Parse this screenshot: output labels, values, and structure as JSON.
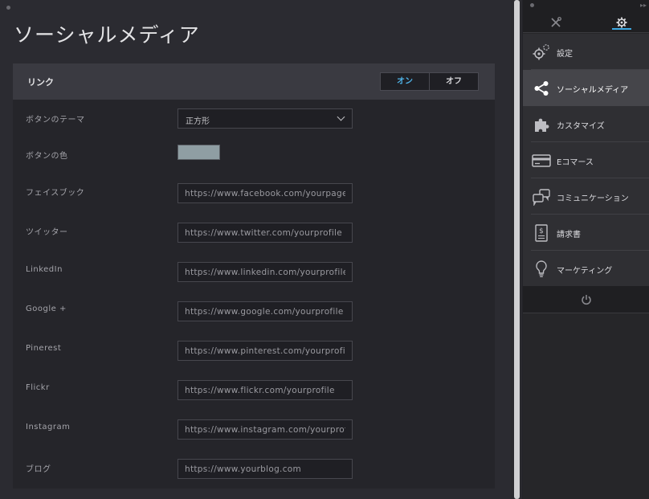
{
  "page": {
    "title": "ソーシャルメディア"
  },
  "section": {
    "title": "リンク",
    "toggle": {
      "on_label": "オン",
      "off_label": "オフ",
      "selected": "on"
    }
  },
  "settings": {
    "theme": {
      "label": "ボタンのテーマ",
      "value": "正方形"
    },
    "color": {
      "label": "ボタンの色",
      "value": "#8f9ea3"
    }
  },
  "links": [
    {
      "label": "フェイスブック",
      "placeholder": "https://www.facebook.com/yourpage"
    },
    {
      "label": "ツイッター",
      "placeholder": "https://www.twitter.com/yourprofile"
    },
    {
      "label": "LinkedIn",
      "placeholder": "https://www.linkedin.com/yourprofile"
    },
    {
      "label": "Google +",
      "placeholder": "https://www.google.com/yourprofile"
    },
    {
      "label": "Pinerest",
      "placeholder": "https://www.pinterest.com/yourprofile"
    },
    {
      "label": "Flickr",
      "placeholder": "https://www.flickr.com/yourprofile"
    },
    {
      "label": "Instagram",
      "placeholder": "https://www.instagram.com/yourprofile"
    },
    {
      "label": "ブログ",
      "placeholder": "https://www.yourblog.com"
    }
  ],
  "sidebar": {
    "tabs": [
      {
        "icon": "tools-icon",
        "active": false
      },
      {
        "icon": "gear-icon",
        "active": true
      }
    ],
    "items": [
      {
        "label": "設定",
        "icon": "gears-icon"
      },
      {
        "label": "ソーシャルメディア",
        "icon": "share-icon",
        "active": true
      },
      {
        "label": "カスタマイズ",
        "icon": "puzzle-icon"
      },
      {
        "label": "Eコマース",
        "icon": "credit-card-icon"
      },
      {
        "label": "コミュニケーション",
        "icon": "chat-bubbles-icon"
      },
      {
        "label": "請求書",
        "icon": "invoice-icon"
      },
      {
        "label": "マーケティング",
        "icon": "lightbulb-icon"
      }
    ],
    "footer_icon": "power-icon"
  },
  "colors": {
    "accent": "#3da9e3",
    "toggle_on": "#4fb3e8"
  }
}
